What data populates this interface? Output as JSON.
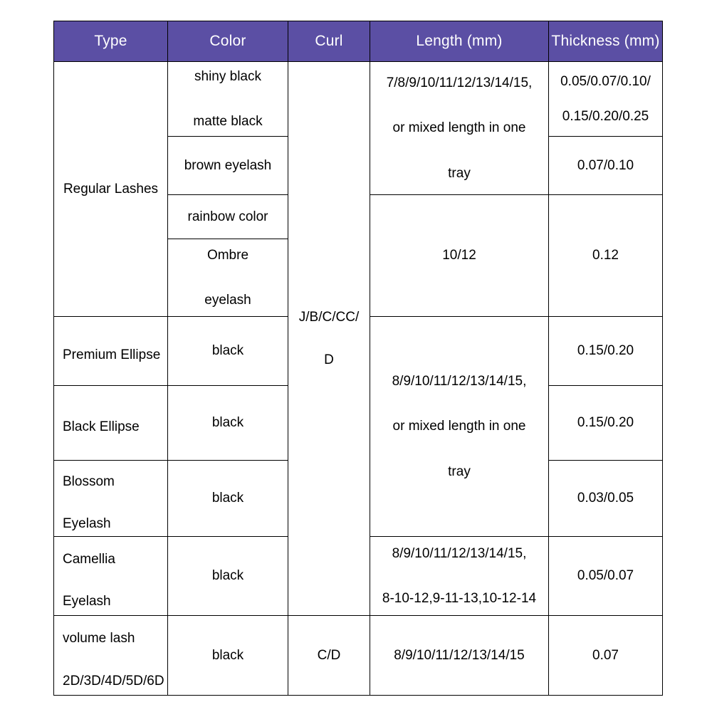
{
  "table": {
    "columns": [
      {
        "key": "type",
        "label": "Type"
      },
      {
        "key": "color",
        "label": "Color"
      },
      {
        "key": "curl",
        "label": "Curl"
      },
      {
        "key": "length",
        "label": "Length (mm)"
      },
      {
        "key": "thickness",
        "label": "Thickness (mm)"
      }
    ],
    "header_bg": "#5b4fa4",
    "header_text_color": "#ffffff",
    "border_color": "#000000",
    "types": {
      "regular_lashes": "Regular Lashes",
      "premium_ellipse": "Premium Ellipse",
      "black_ellipse": "Black Ellipse",
      "blossom_line1": "Blossom",
      "blossom_line2": "Eyelash",
      "camellia_line1": "Camellia",
      "camellia_line2": "Eyelash",
      "volume_line1": "volume lash",
      "volume_line2": "2D/3D/4D/5D/6D"
    },
    "colors": {
      "shiny_black": "shiny black",
      "matte_black": "matte black",
      "brown_eyelash": "brown   eyelash",
      "rainbow_color": "rainbow   color",
      "ombre_line1": "Ombre",
      "ombre_line2": "eyelash",
      "black_premium_ellipse": "black",
      "black_black_ellipse": "black",
      "black_blossom": "black",
      "black_camellia": "black",
      "black_volume": "black"
    },
    "curls": {
      "main_line1": "J/B/C/CC/",
      "main_line2": "D",
      "volume": "C/D"
    },
    "lengths": {
      "regular_a_line1": "7/8/9/10/11/12/13/14/15,",
      "regular_a_line2": "or mixed length in one",
      "regular_a_line3": "tray",
      "regular_b": "10/12",
      "ellipse_line1": "8/9/10/11/12/13/14/15,",
      "ellipse_line2": "or mixed length in one",
      "ellipse_line3": "tray",
      "camellia_line1": "8/9/10/11/12/13/14/15,",
      "camellia_line2": "8-10-12,9-11-13,10-12-14",
      "volume": "8/9/10/11/12/13/14/15"
    },
    "thicknesses": {
      "shiny_matte_line1": "0.05/0.07/0.10/",
      "shiny_matte_line2": "0.15/0.20/0.25",
      "brown": "0.07/0.10",
      "rainbow_ombre": "0.12",
      "premium_ellipse": "0.15/0.20",
      "black_ellipse": "0.15/0.20",
      "blossom": "0.03/0.05",
      "camellia": "0.05/0.07",
      "volume": "0.07"
    }
  }
}
